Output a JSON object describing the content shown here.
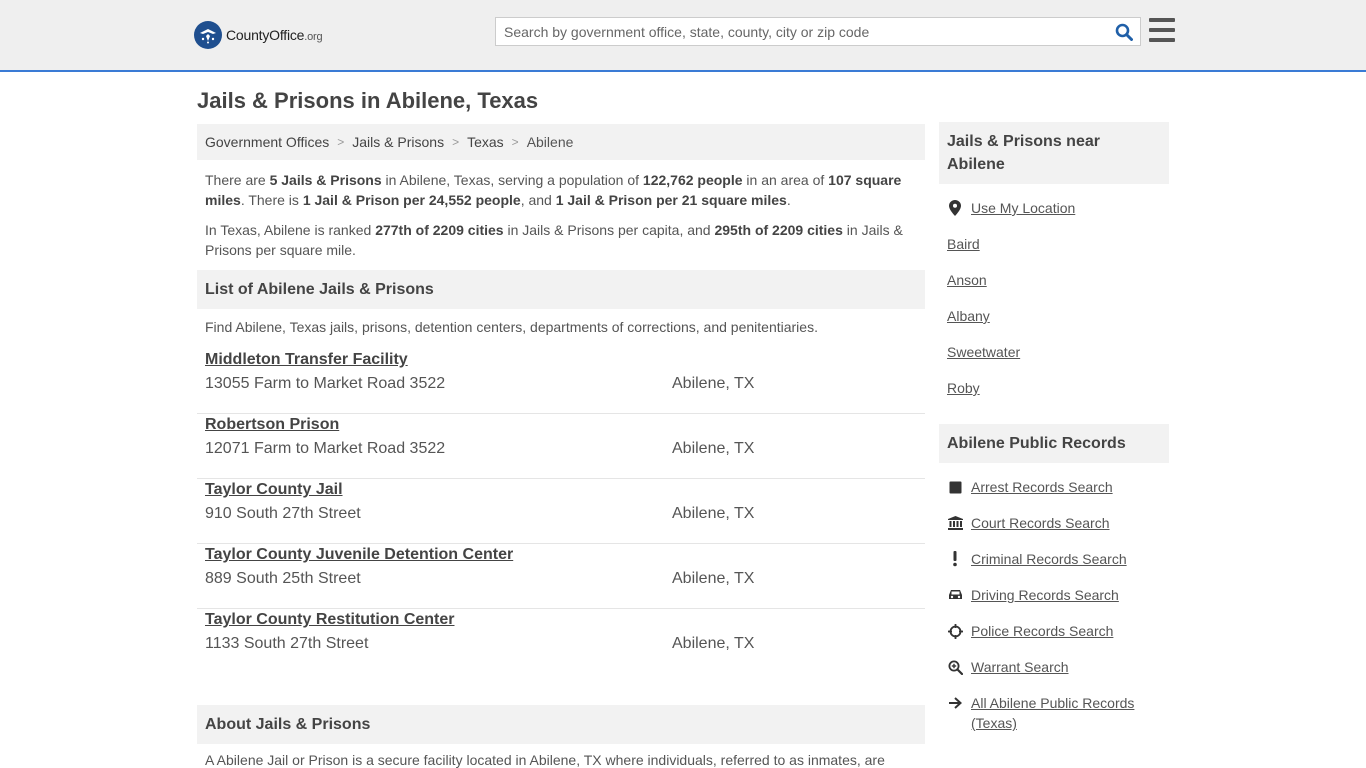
{
  "header": {
    "logo_name": "CountyOffice",
    "logo_tld": ".org",
    "search_placeholder": "Search by government office, state, county, city or zip code",
    "search_value": ""
  },
  "page": {
    "title": "Jails & Prisons in Abilene, Texas"
  },
  "breadcrumb": [
    "Government Offices",
    "Jails & Prisons",
    "Texas",
    "Abilene"
  ],
  "intro": {
    "p1": {
      "t1": "There are ",
      "b1": "5 Jails & Prisons",
      "t2": " in Abilene, Texas, serving a population of ",
      "b2": "122,762 people",
      "t3": " in an area of ",
      "b3": "107 square miles",
      "t4": ". There is ",
      "b4": "1 Jail & Prison per 24,552 people",
      "t5": ", and ",
      "b5": "1 Jail & Prison per 21 square miles",
      "t6": "."
    },
    "p2": {
      "t1": "In Texas, Abilene is ranked ",
      "b1": "277th of 2209 cities",
      "t2": " in Jails & Prisons per capita, and ",
      "b2": "295th of 2209 cities",
      "t3": " in Jails & Prisons per square mile."
    }
  },
  "list": {
    "heading": "List of Abilene Jails & Prisons",
    "description": "Find Abilene, Texas jails, prisons, detention centers, departments of corrections, and penitentiaries.",
    "items": [
      {
        "name": "Middleton Transfer Facility",
        "address": "13055 Farm to Market Road 3522",
        "city": "Abilene, TX"
      },
      {
        "name": "Robertson Prison",
        "address": "12071 Farm to Market Road 3522",
        "city": "Abilene, TX"
      },
      {
        "name": "Taylor County Jail",
        "address": "910 South 27th Street",
        "city": "Abilene, TX"
      },
      {
        "name": "Taylor County Juvenile Detention Center",
        "address": "889 South 25th Street",
        "city": "Abilene, TX"
      },
      {
        "name": "Taylor County Restitution Center",
        "address": "1133 South 27th Street",
        "city": "Abilene, TX"
      }
    ]
  },
  "about": {
    "heading": "About Jails & Prisons",
    "text": "A Abilene Jail or Prison is a secure facility located in Abilene, TX where individuals, referred to as inmates, are"
  },
  "sidebar": {
    "nearby_heading": "Jails & Prisons near Abilene",
    "use_location": "Use My Location",
    "nearby": [
      "Baird",
      "Anson",
      "Albany",
      "Sweetwater",
      "Roby"
    ],
    "records_heading": "Abilene Public Records",
    "records": [
      {
        "label": "Arrest Records Search",
        "icon": "square-icon"
      },
      {
        "label": "Court Records Search",
        "icon": "courthouse-icon"
      },
      {
        "label": "Criminal Records Search",
        "icon": "exclamation-icon"
      },
      {
        "label": "Driving Records Search",
        "icon": "car-icon"
      },
      {
        "label": "Police Records Search",
        "icon": "crosshair-icon"
      },
      {
        "label": "Warrant Search",
        "icon": "magnifier-icon"
      },
      {
        "label": "All Abilene Public Records (Texas)",
        "icon": "arrow-right-icon"
      }
    ]
  },
  "colors": {
    "header_bg": "#efefef",
    "header_border": "#3a7bd5",
    "logo_blue": "#1f4f8f",
    "search_icon": "#1f5fa8",
    "panel_bg": "#f2f2f2"
  }
}
